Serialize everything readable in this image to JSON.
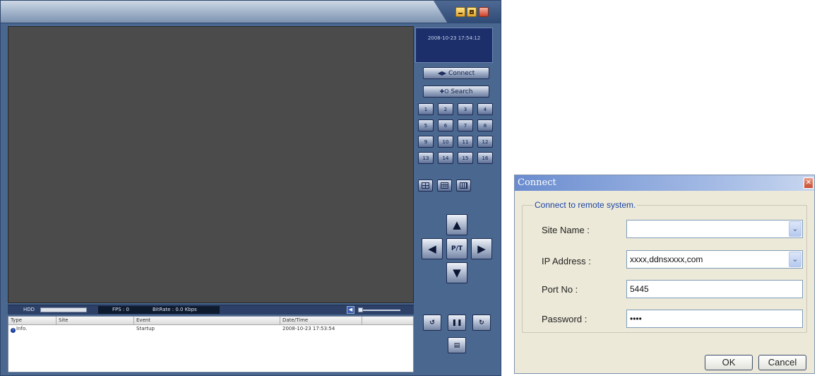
{
  "dvr": {
    "datetime": "2008-10-23 17:54:12",
    "connect_label": "Connect",
    "search_label": "Search",
    "channels": [
      "1",
      "2",
      "3",
      "4",
      "5",
      "6",
      "7",
      "8",
      "9",
      "10",
      "11",
      "12",
      "13",
      "14",
      "15",
      "16"
    ],
    "ptz_center_label": "P/T",
    "status": {
      "hdd_label": "HDD",
      "fps_text": "FPS : 0",
      "bitrate_text": "BitRate : 0.0 Kbps"
    },
    "log": {
      "columns": [
        "Type",
        "Site",
        "Event",
        "Date/Time"
      ],
      "rows": [
        {
          "type": "Info.",
          "site": "",
          "event": "Startup",
          "datetime": "2008-10-23 17:53:54"
        }
      ]
    },
    "colors": {
      "window_blue": "#4a6790",
      "video_bg": "#4b4b4b",
      "clock_bg": "#1c2f6b"
    },
    "icons": [
      "minimize-icon",
      "maximize-icon",
      "close-icon",
      "connect-icon",
      "search-icon",
      "arrow-up-icon",
      "arrow-left-icon",
      "arrow-right-icon",
      "arrow-down-icon",
      "volume-icon",
      "rewind-icon",
      "pause-icon",
      "forward-icon",
      "save-icon"
    ]
  },
  "dialog": {
    "title": "Connect",
    "group_label": "Connect to remote system.",
    "site_label": "Site Name :",
    "site_value": "",
    "ip_label": "IP Address :",
    "ip_value": "xxxx,ddnsxxxx,com",
    "port_label": "Port No :",
    "port_value": "5445",
    "password_label": "Password :",
    "password_value": "••••",
    "ok_label": "OK",
    "cancel_label": "Cancel",
    "colors": {
      "title_bar": "#6a8ccf",
      "face": "#ece9d8",
      "group_label": "#1c44a6"
    }
  }
}
